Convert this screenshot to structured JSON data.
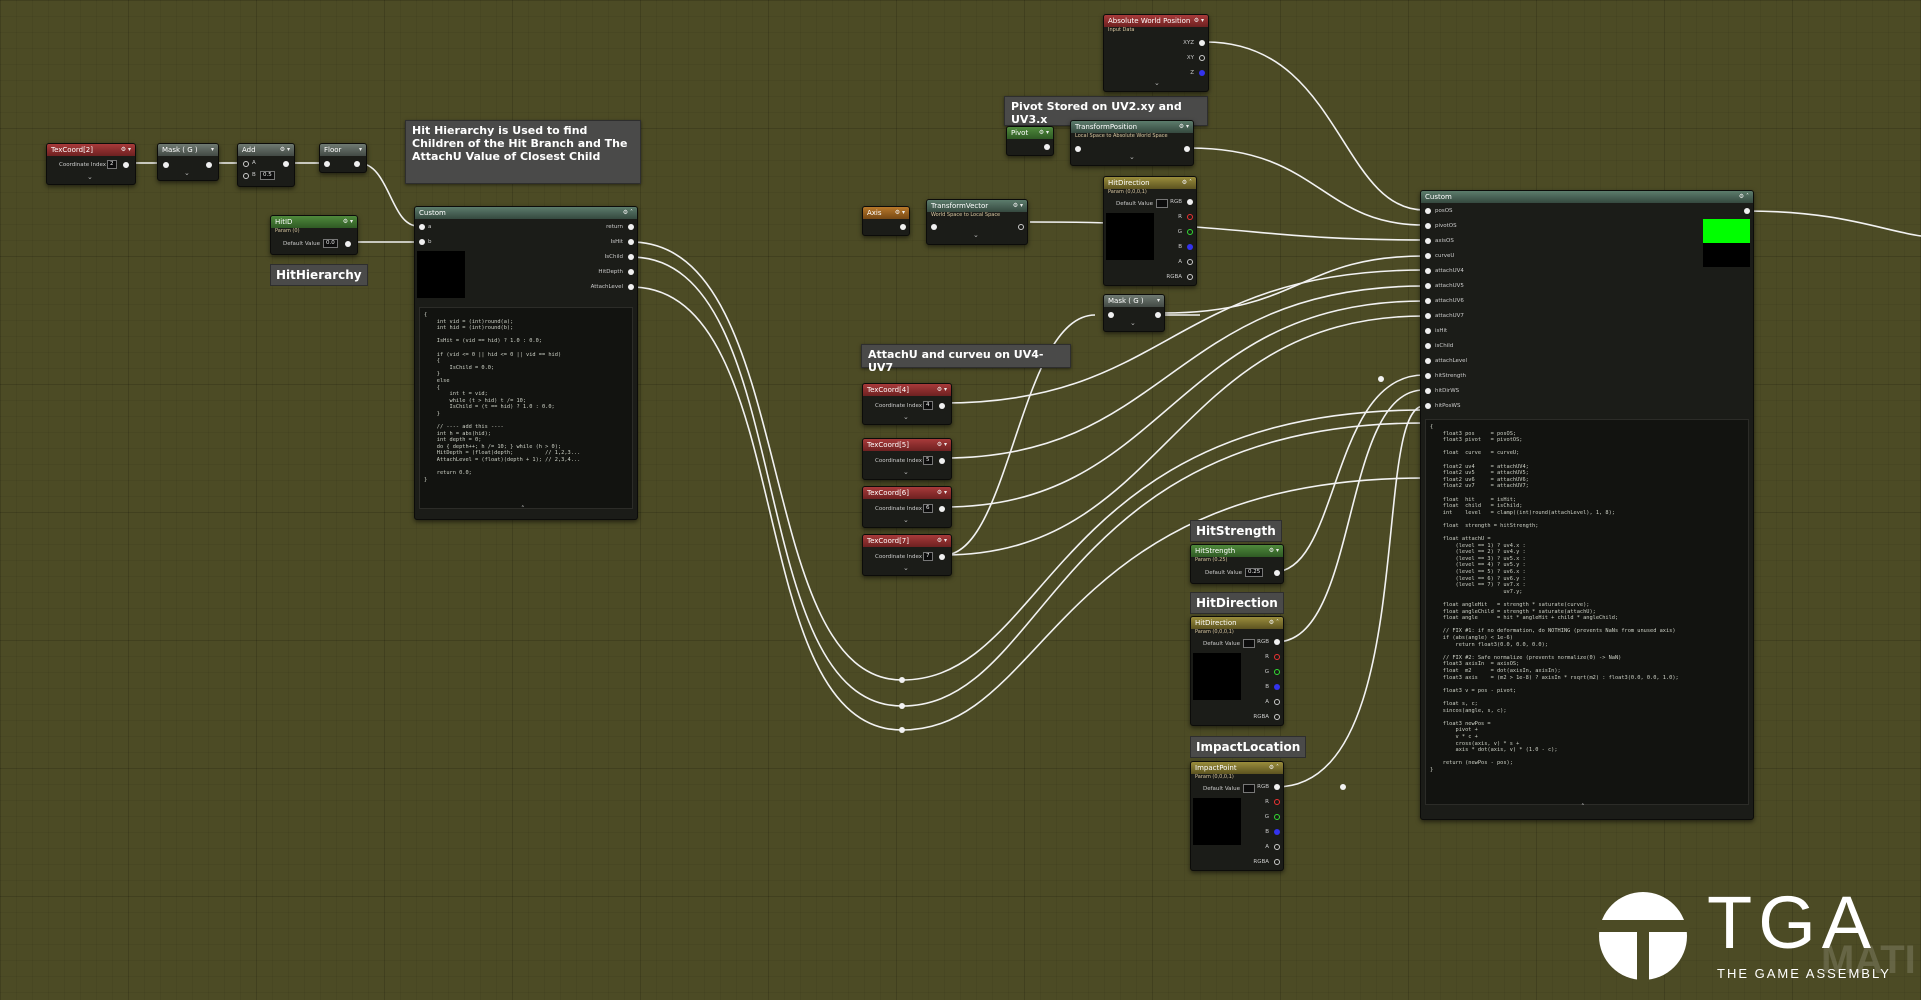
{
  "comments": {
    "hit_hierarchy": "Hit Hierarchy is Used to find Children of the Hit Branch and The AttachU Value of Closest Child",
    "pivot": "Pivot Stored on UV2.xy and UV3.x",
    "attach": "AttachU and curveu on UV4-UV7"
  },
  "labels": {
    "hithierarchy": "HitHierarchy",
    "hitstrength": "HitStrength",
    "hitdirection": "HitDirection",
    "impactlocation": "ImpactLocation"
  },
  "nodes": {
    "texcoord2": {
      "title": "TexCoord[2]",
      "pin_label": "Coordinate Index",
      "value": "2"
    },
    "mask1": {
      "title": "Mask ( G )"
    },
    "add": {
      "title": "Add",
      "pin_a": "A",
      "pin_b": "B",
      "b_value": "0.5"
    },
    "floor": {
      "title": "Floor"
    },
    "hitid": {
      "title": "HitID",
      "subtitle": "Param (0)",
      "pin_label": "Default Value",
      "value": "0.0"
    },
    "custom1": {
      "title": "Custom",
      "inputs": [
        "a",
        "b"
      ],
      "outputs": [
        "return",
        "IsHit",
        "IsChild",
        "HitDepth",
        "AttachLevel"
      ]
    },
    "abs_world": {
      "title": "Absolute World Position",
      "subtitle": "Input Data",
      "outputs": [
        "XYZ",
        "XY",
        "Z"
      ]
    },
    "pivot_mask": {
      "title": "Pivot"
    },
    "transform_pos": {
      "title": "TransformPosition",
      "subtitle": "Local Space to Absolute World Space"
    },
    "axis": {
      "title": "Axis"
    },
    "transform_vec": {
      "title": "TransformVector",
      "subtitle": "World Space to Local Space"
    },
    "hitdir_top": {
      "title": "HitDirection",
      "subtitle": "Param (0,0,0,1)",
      "pin_label": "Default Value",
      "outputs": [
        "RGB",
        "R",
        "G",
        "B",
        "A",
        "RGBA"
      ]
    },
    "mask2": {
      "title": "Mask ( G )"
    },
    "texcoord4": {
      "title": "TexCoord[4]",
      "pin_label": "Coordinate Index",
      "value": "4"
    },
    "texcoord5": {
      "title": "TexCoord[5]",
      "pin_label": "Coordinate Index",
      "value": "5"
    },
    "texcoord6": {
      "title": "TexCoord[6]",
      "pin_label": "Coordinate Index",
      "value": "6"
    },
    "texcoord7": {
      "title": "TexCoord[7]",
      "pin_label": "Coordinate Index",
      "value": "7"
    },
    "hitstrength": {
      "title": "HitStrength",
      "subtitle": "Param (0.25)",
      "pin_label": "Default Value",
      "value": "0.25"
    },
    "hitdirection": {
      "title": "HitDirection",
      "subtitle": "Param (0,0,0,1)",
      "pin_label": "Default Value",
      "outputs": [
        "RGB",
        "R",
        "G",
        "B",
        "A",
        "RGBA"
      ]
    },
    "impactpoint": {
      "title": "ImpactPoint",
      "subtitle": "Param (0,0,0,1)",
      "pin_label": "Default Value",
      "outputs": [
        "RGB",
        "R",
        "G",
        "B",
        "A",
        "RGBA"
      ]
    },
    "custom2": {
      "title": "Custom",
      "inputs": [
        "posOS",
        "pivotOS",
        "axisOS",
        "curveU",
        "attachUV4",
        "attachUV5",
        "attachUV6",
        "attachUV7",
        "isHit",
        "isChild",
        "attachLevel",
        "hitStrength",
        "hitDirWS",
        "hitPosWS"
      ]
    }
  },
  "code1": "{\n    int vid = (int)round(a);\n    int hid = (int)round(b);\n\n    IsHit = (vid == hid) ? 1.0 : 0.0;\n\n    if (vid <= 0 || hid <= 0 || vid == hid)\n    {\n        IsChild = 0.0;\n    }\n    else\n    {\n        int t = vid;\n        while (t > hid) t /= 10;\n        IsChild = (t == hid) ? 1.0 : 0.0;\n    }\n\n    // ---- add this ----\n    int h = abs(hid);\n    int depth = 0;\n    do { depth++; h /= 10; } while (h > 0);\n    HitDepth = (float)depth;          // 1,2,3...\n    AttachLevel = (float)(depth + 1); // 2,3,4...\n\n    return 0.0;\n}",
  "code2": "{\n    float3 pos     = posOS;\n    float3 pivot   = pivotOS;\n\n    float  curve   = curveU;\n\n    float2 uv4     = attachUV4;\n    float2 uv5     = attachUV5;\n    float2 uv6     = attachUV6;\n    float2 uv7     = attachUV7;\n\n    float  hit     = isHit;\n    float  child   = isChild;\n    int    level   = clamp((int)round(attachLevel), 1, 8);\n\n    float  strength = hitStrength;\n\n    float attachU =\n        (level == 1) ? uv4.x :\n        (level == 2) ? uv4.y :\n        (level == 3) ? uv5.x :\n        (level == 4) ? uv5.y :\n        (level == 5) ? uv6.x :\n        (level == 6) ? uv6.y :\n        (level == 7) ? uv7.x :\n                       uv7.y;\n\n    float angleHit   = strength * saturate(curve);\n    float angleChild = strength * saturate(attachU);\n    float angle      = hit * angleHit + child * angleChild;\n\n    // FIX #1: if no deformation, do NOTHING (prevents NaNs from unused axis)\n    if (abs(angle) < 1e-6)\n        return float3(0.0, 0.0, 0.0);\n\n    // FIX #2: Safe normalize (prevents normalize(0) -> NaN)\n    float3 axisIn  = axisOS;\n    float  m2      = dot(axisIn, axisIn);\n    float3 axis    = (m2 > 1e-8) ? axisIn * rsqrt(m2) : float3(0.0, 0.0, 1.0);\n\n    float3 v = pos - pivot;\n\n    float s, c;\n    sincos(angle, s, c);\n\n    float3 newPos =\n        pivot +\n        v * c +\n        cross(axis, v) * s +\n        axis * dot(axis, v) * (1.0 - c);\n\n    return (newPos - pos);\n}",
  "logo": {
    "text": "TGA",
    "tagline": "THE GAME ASSEMBLY",
    "watermark": "MATI"
  },
  "colors": {
    "background": "#4c4b25",
    "wire": "#f2f2f2",
    "preview_green": "#00ff00"
  }
}
